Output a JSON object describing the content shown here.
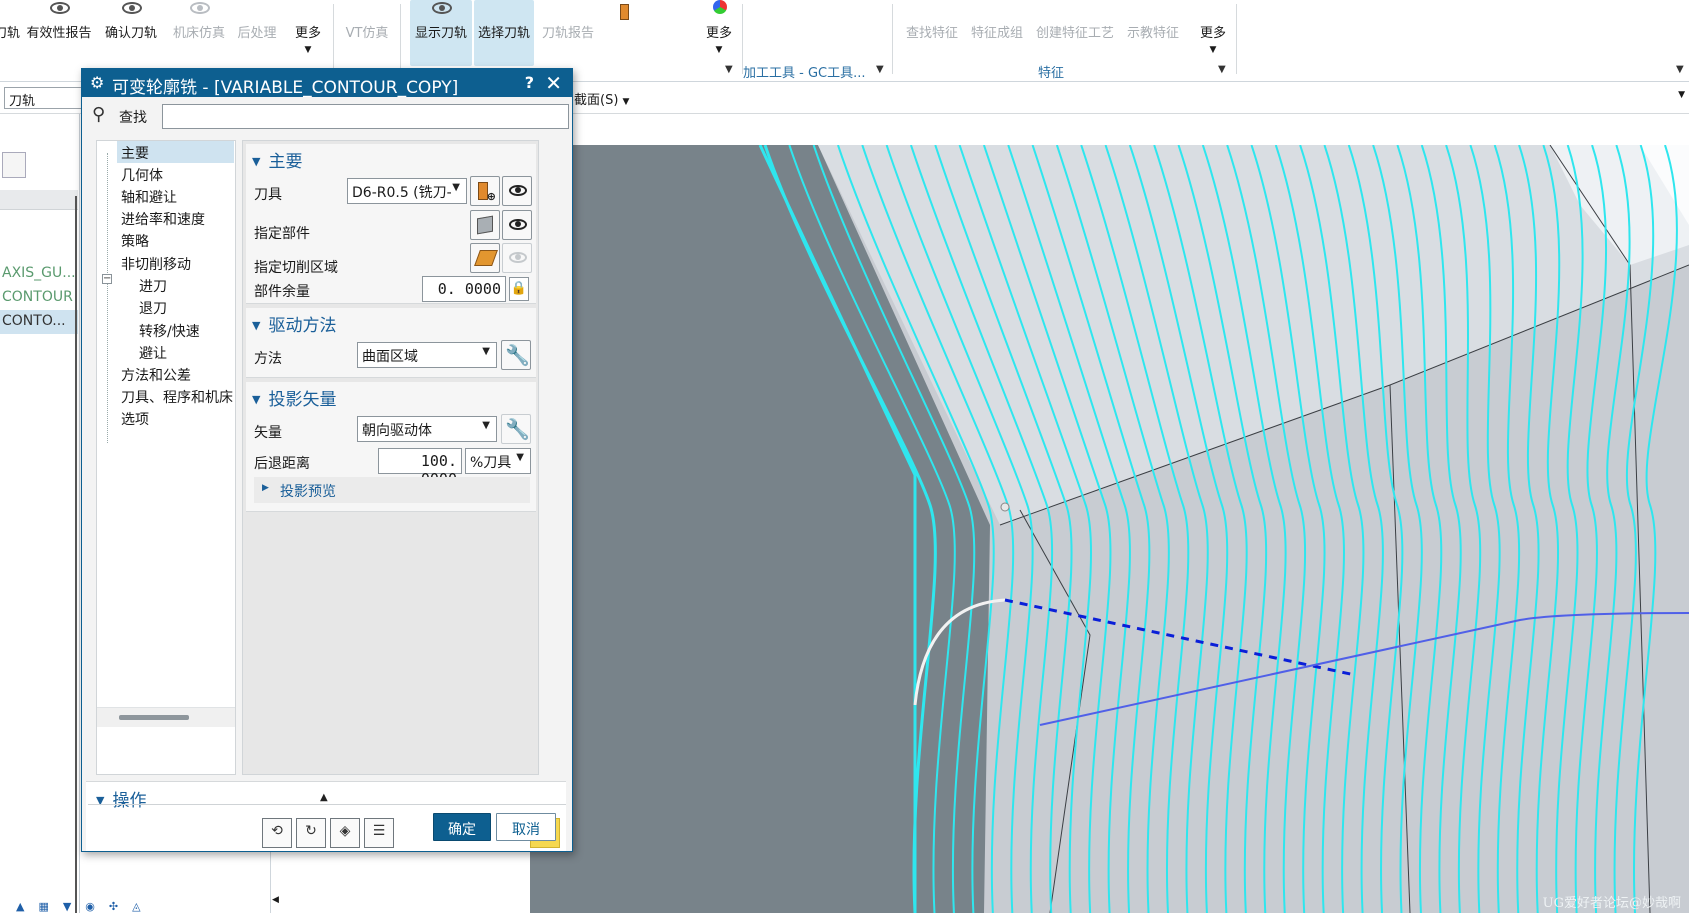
{
  "ribbon": {
    "buttons": [
      {
        "label": "刀轨",
        "disabled": false
      },
      {
        "label": "有效性报告",
        "disabled": false
      },
      {
        "label": "确认刀轨",
        "disabled": false
      },
      {
        "label": "机床仿真",
        "disabled": true
      },
      {
        "label": "后处理",
        "disabled": true
      },
      {
        "label": "更多",
        "disabled": false
      },
      {
        "label": "VT仿真",
        "disabled": true
      },
      {
        "label": "显示刀轨",
        "disabled": false,
        "active": true
      },
      {
        "label": "选择刀轨",
        "disabled": false,
        "active": true
      },
      {
        "label": "刀轨报告",
        "disabled": true
      },
      {
        "label": "更多",
        "disabled": false
      },
      {
        "label": "查找特征",
        "disabled": true
      },
      {
        "label": "特征成组",
        "disabled": true
      },
      {
        "label": "创建特征工艺",
        "disabled": true
      },
      {
        "label": "示教特征",
        "disabled": true
      },
      {
        "label": "更多",
        "disabled": false
      }
    ],
    "group_labels": {
      "process_tools": "加工工具 - GC工具...",
      "feature": "特征"
    }
  },
  "toolbar2": {
    "filter_value": "刀轨",
    "section_menu": "截面(S)"
  },
  "navigator": {
    "rows": [
      "AXIS_GU...",
      "CONTOUR",
      "CONTO..."
    ]
  },
  "dialog": {
    "title": "可变轮廓铣 - [VARIABLE_CONTOUR_COPY]",
    "help": "?",
    "close": "✕",
    "find_label": "查找",
    "find_value": "",
    "tree": [
      {
        "label": "主要",
        "level": 0,
        "selected": true
      },
      {
        "label": "几何体",
        "level": 0
      },
      {
        "label": "轴和避让",
        "level": 0
      },
      {
        "label": "进给率和速度",
        "level": 0
      },
      {
        "label": "策略",
        "level": 0
      },
      {
        "label": "非切削移动",
        "level": 0
      },
      {
        "label": "进刀",
        "level": 1
      },
      {
        "label": "退刀",
        "level": 1
      },
      {
        "label": "转移/快速",
        "level": 1
      },
      {
        "label": "避让",
        "level": 1
      },
      {
        "label": "方法和公差",
        "level": 0
      },
      {
        "label": "刀具、程序和机床",
        "level": 0
      },
      {
        "label": "选项",
        "level": 0
      }
    ],
    "main": {
      "header": "主要",
      "tool_label": "刀具",
      "tool_value": "D6-R0.5 (铣刀-",
      "part_label": "指定部件",
      "cut_area_label": "指定切削区域",
      "stock_label": "部件余量",
      "stock_value": "0. 0000"
    },
    "drive": {
      "header": "驱动方法",
      "method_label": "方法",
      "method_value": "曲面区域"
    },
    "projection": {
      "header": "投影矢量",
      "vector_label": "矢量",
      "vector_value": "朝向驱动体",
      "retract_label": "后退距离",
      "retract_value": "100. 0000",
      "retract_unit": "%刀具",
      "preview_label": "投影预览"
    },
    "operations_header": "操作",
    "ok": "确定",
    "cancel": "取消"
  },
  "viewport": {
    "watermark": "UG爱好者论坛@妙哉啊"
  },
  "colors": {
    "title_bar": "#0d5f90",
    "toolpath": "#2fe6ee",
    "background_3d": "#78838a",
    "section_header": "#1a5f99"
  }
}
